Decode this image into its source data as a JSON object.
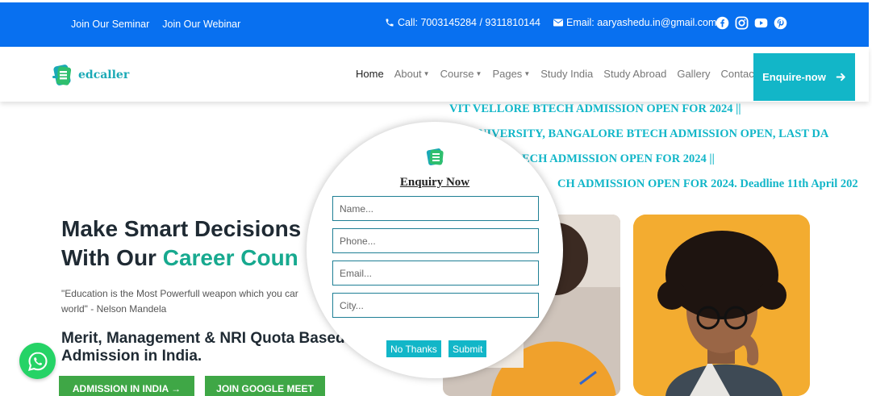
{
  "topbar": {
    "link_seminar": "Join Our Seminar",
    "link_webinar": "Join Our Webinar",
    "call": "Call: 7003145284 / 9311810144",
    "email": "Email: aaryashedu.in@gmail.com",
    "social_icons": [
      "facebook-icon",
      "instagram-icon",
      "youtube-icon",
      "pinterest-icon"
    ]
  },
  "nav": {
    "logo_text": "edcaller",
    "items": [
      "Home",
      "About",
      "Course",
      "Pages",
      "Study India",
      "Study Abroad",
      "Gallery",
      "Contact"
    ],
    "enquire_label": "Enquire-now"
  },
  "ticker": {
    "lines": [
      "VIT VELLORE BTECH ADMISSION OPEN FOR 2024 ||",
      "NIVERSITY, BANGALORE BTECH ADMISSION OPEN, LAST DA",
      "ECH ADMISSION OPEN FOR 2024 ||",
      "CH ADMISSION OPEN FOR 2024. Deadline 11th April 202"
    ]
  },
  "hero": {
    "title_line1": "Make Smart Decisions",
    "title_line2_prefix": "With Our ",
    "title_line2_accent": "Career Coun",
    "quote_line1": "\"Education is the Most Powerfull weapon which you car",
    "quote_line2": "world\" - Nelson Mandela",
    "subhead_line1": "Merit, Management & NRI Quota Based",
    "subhead_line2": "Admission in India.",
    "btn_admission": "ADMISSION IN INDIA →",
    "btn_meet": "JOIN GOOGLE MEET"
  },
  "modal": {
    "title": "Enquiry Now",
    "name_placeholder": "Name...",
    "phone_placeholder": "Phone...",
    "email_placeholder": "Email...",
    "city_placeholder": "City...",
    "no_thanks": "No Thanks",
    "submit": "Submit"
  },
  "colors": {
    "topbar": "#0870f0",
    "teal": "#12b6c8",
    "green": "#3fa746",
    "accent": "#17a98f"
  }
}
